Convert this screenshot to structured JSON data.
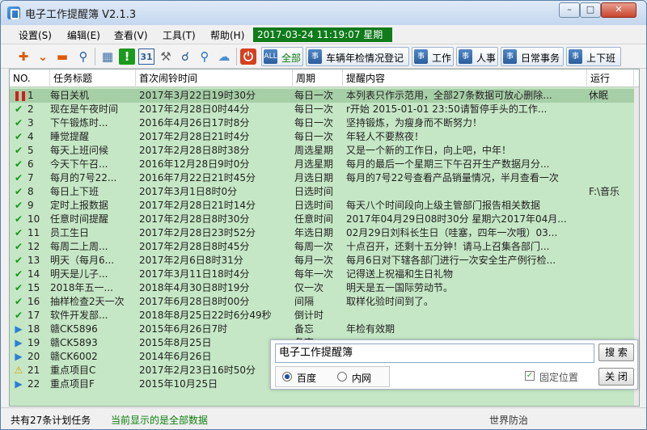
{
  "window": {
    "title": "电子工作提醒簿 V2.1.3"
  },
  "menu": {
    "items": [
      "设置(S)",
      "编辑(E)",
      "查看(V)",
      "工具(T)",
      "帮助(H)"
    ],
    "clock": "2017-03-24 11:19:07  星期五"
  },
  "toolbar": {
    "icons": [
      "add-icon",
      "expand-icon",
      "remove-icon",
      "search-icon",
      "calendar-icon",
      "alert-icon",
      "calendar-31-icon",
      "tools-icon",
      "find-icon",
      "zoom-icon",
      "weather-icon",
      "power-icon"
    ],
    "category_tabs": [
      {
        "badge": "ALL",
        "label": "全部"
      },
      {
        "badge": "事",
        "label": "车辆年检情况登记"
      },
      {
        "badge": "事",
        "label": "工作"
      },
      {
        "badge": "事",
        "label": "人事"
      },
      {
        "badge": "事",
        "label": "日常事务"
      },
      {
        "badge": "事",
        "label": "上下班"
      }
    ]
  },
  "table": {
    "headers": [
      "NO.",
      "任务标题",
      "首次闹铃时间",
      "周期",
      "提醒内容",
      "运行"
    ],
    "rows": [
      {
        "icon": "pause",
        "no": "1",
        "title": "每日关机",
        "time": "2017年3月22日19时30分",
        "cycle": "每日一次",
        "content": "本列表只作示范用，全部27条数据可放心删除...",
        "run": "休眠"
      },
      {
        "icon": "check",
        "no": "2",
        "title": "现在是午夜时间",
        "time": "2017年2月28日0时44分",
        "cycle": "每日一次",
        "content": "r开始 2015-01-01 23:50请暂停手头的工作...",
        "run": ""
      },
      {
        "icon": "check",
        "no": "3",
        "title": "下午锻炼时...",
        "time": "2016年4月26日17时8分",
        "cycle": "每日一次",
        "content": "坚持锻炼，为瘦身而不断努力！",
        "run": ""
      },
      {
        "icon": "check",
        "no": "4",
        "title": "睡觉提醒",
        "time": "2017年2月28日21时4分",
        "cycle": "每日一次",
        "content": "年轻人不要熬夜！",
        "run": ""
      },
      {
        "icon": "check",
        "no": "5",
        "title": "每天上班问候",
        "time": "2017年2月28日8时38分",
        "cycle": "周选星期",
        "content": "又是一个新的工作日，向上吧，中年！",
        "run": ""
      },
      {
        "icon": "check",
        "no": "6",
        "title": "今天下午召...",
        "time": "2016年12月28日9时0分",
        "cycle": "月选星期",
        "content": "每月的最后一个星期三下午召开生产数据月分...",
        "run": ""
      },
      {
        "icon": "check",
        "no": "7",
        "title": "每月的7号22...",
        "time": "2016年7月22日21时45分",
        "cycle": "月选日期",
        "content": "每月的7号22号查看产品销量情况，半月查看一次",
        "run": ""
      },
      {
        "icon": "check",
        "no": "8",
        "title": "每日上下班",
        "time": "2017年3月1日8时0分",
        "cycle": "日选时间",
        "content": "",
        "run": "F:\\音乐"
      },
      {
        "icon": "check",
        "no": "9",
        "title": "定时上报数据",
        "time": "2017年2月28日21时14分",
        "cycle": "日选时间",
        "content": "每天八个时间段向上级主管部门报告相关数据",
        "run": ""
      },
      {
        "icon": "check",
        "no": "10",
        "title": "任意时间提醒",
        "time": "2017年2月28日8时30分",
        "cycle": "任意时间",
        "content": "2017年04月29日08时30分 星期六2017年04月...",
        "run": ""
      },
      {
        "icon": "check",
        "no": "11",
        "title": "员工生日",
        "time": "2017年2月28日23时52分",
        "cycle": "年选日期",
        "content": "02月29日刘科长生日（哇塞，四年一次哦）03...",
        "run": ""
      },
      {
        "icon": "check",
        "no": "12",
        "title": "每周二上周...",
        "time": "2017年2月28日8时45分",
        "cycle": "每周一次",
        "content": "十点召开，还剩十五分钟！请马上召集各部门...",
        "run": ""
      },
      {
        "icon": "check",
        "no": "13",
        "title": "明天（每月6...",
        "time": "2017年2月6日8时31分",
        "cycle": "每月一次",
        "content": "每月6日对下辖各部门进行一次安全生产例行检...",
        "run": ""
      },
      {
        "icon": "check",
        "no": "14",
        "title": "明天是儿子...",
        "time": "2017年3月11日18时4分",
        "cycle": "每年一次",
        "content": "记得送上祝福和生日礼物",
        "run": ""
      },
      {
        "icon": "check",
        "no": "15",
        "title": "2018年五一...",
        "time": "2018年4月30日8时19分",
        "cycle": "仅一次",
        "content": "明天是五一国际劳动节。",
        "run": ""
      },
      {
        "icon": "check",
        "no": "16",
        "title": "抽样检查2天一次",
        "time": "2017年6月28日8时00分",
        "cycle": "间隔",
        "content": "取样化验时间到了。",
        "run": ""
      },
      {
        "icon": "check",
        "no": "17",
        "title": "软件开发部...",
        "time": "2018年8月25日22时6分49秒",
        "cycle": "倒计时",
        "content": "",
        "run": ""
      },
      {
        "icon": "play",
        "no": "18",
        "title": "赣CK5896",
        "time": "2015年6月26日7时",
        "cycle": "备忘",
        "content": "年检有效期",
        "run": ""
      },
      {
        "icon": "play",
        "no": "19",
        "title": "赣CK5893",
        "time": "2015年8月25日",
        "cycle": "备忘",
        "content": "",
        "run": ""
      },
      {
        "icon": "play",
        "no": "20",
        "title": "赣CK6002",
        "time": "2014年6月26日",
        "cycle": "备忘",
        "content": "",
        "run": ""
      },
      {
        "icon": "warn",
        "no": "21",
        "title": "重点项目C",
        "time": "2017年2月23日16时50分",
        "cycle": "",
        "content": "",
        "run": ""
      },
      {
        "icon": "play",
        "no": "22",
        "title": "重点项目F",
        "time": "2015年10月25日",
        "cycle": "",
        "content": "",
        "run": ""
      }
    ]
  },
  "popup": {
    "search_value": "电子工作提醒簿",
    "search_button": "搜 索",
    "radio_options": [
      "百度",
      "内网"
    ],
    "selected_radio": "百度",
    "checkbox_label": "固定位置",
    "close_button": "关 闭"
  },
  "status": {
    "count_text": "共有27条计划任务",
    "filter_text": "当前显示的是全部数据",
    "right_text": "世界防治"
  }
}
